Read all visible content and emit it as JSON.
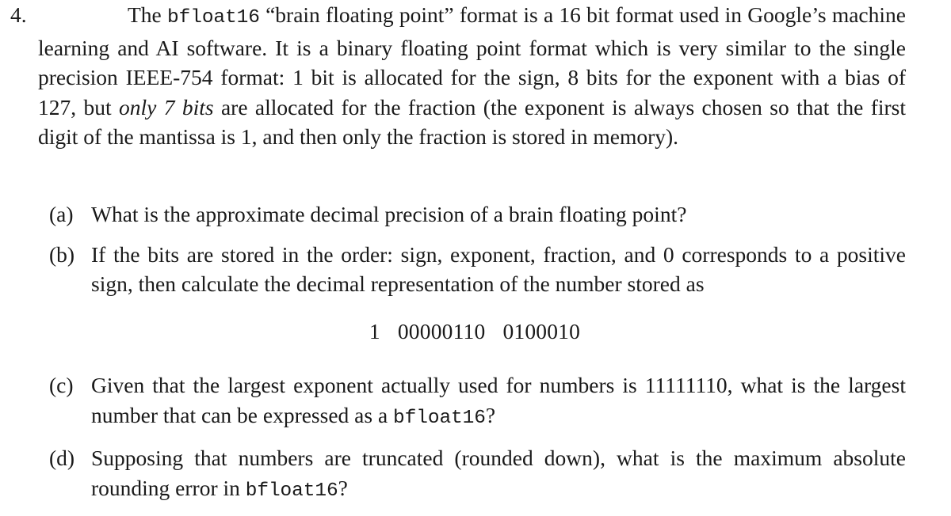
{
  "problem": {
    "number": "4.",
    "intro": {
      "part1": "The ",
      "code1": "bfloat16",
      "part2": " “brain floating point” format is a 16 bit format used in Google’s machine learning and AI software.  It is a binary floating point format which is very similar to the single precision IEEE-754 format: 1 bit is allocated for the sign, 8 bits for the exponent with a bias of 127, but ",
      "emphasis": "only 7 bits",
      "part3": " are allocated for the fraction (the exponent is always chosen so that the first digit of the mantissa is 1, and then only the fraction is stored in memory)."
    },
    "subitems": [
      {
        "label": "(a)",
        "text": "What is the approximate decimal precision of a brain floating point?"
      },
      {
        "label": "(b)",
        "text": "If the bits are stored in the order: sign, exponent, fraction, and 0 corresponds to a positive sign, then calculate the decimal representation of the number stored as",
        "display_equation": {
          "sign_bit": "1",
          "exponent_bits": "00000110",
          "fraction_bits": "0100010"
        }
      },
      {
        "label": "(c)",
        "text_before": "Given that the largest exponent actually used for numbers is 11111110, what is the largest number that can be expressed as a ",
        "code": "bfloat16",
        "text_after": "?",
        "largest_exponent": "11111110"
      },
      {
        "label": "(d)",
        "text_before": "Supposing that numbers are truncated (rounded down), what is the maximum absolute rounding error in ",
        "code": "bfloat16",
        "text_after": "?"
      }
    ]
  }
}
